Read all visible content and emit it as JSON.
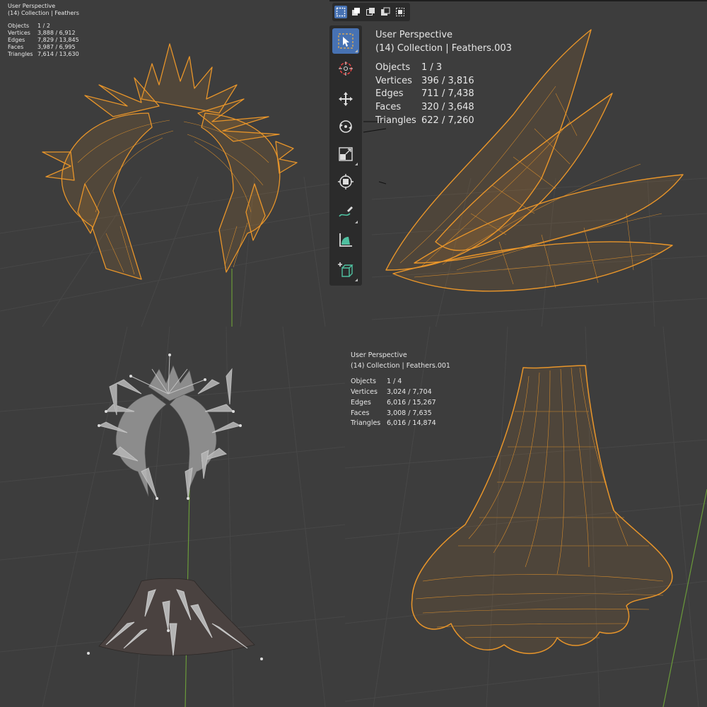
{
  "colors": {
    "wire": "#e8952a",
    "background": "#3d3d3d",
    "grid": "#4a4a4a",
    "axis_y": "#6a9a3a",
    "active_tool": "#4772b3",
    "bone": "#b4b4b4"
  },
  "viewports": {
    "top_left": {
      "title": "User Perspective",
      "subtitle": "(14) Collection | Feathers",
      "stats": [
        {
          "label": "Objects",
          "value": "1 / 2"
        },
        {
          "label": "Vertices",
          "value": "3,888 / 6,912"
        },
        {
          "label": "Edges",
          "value": "7,829 / 13,845"
        },
        {
          "label": "Faces",
          "value": "3,987 / 6,995"
        },
        {
          "label": "Triangles",
          "value": "7,614 / 13,630"
        }
      ]
    },
    "top_right": {
      "title": "User Perspective",
      "subtitle": "(14) Collection | Feathers.003",
      "stats": [
        {
          "label": "Objects",
          "value": "1 / 3"
        },
        {
          "label": "Vertices",
          "value": "396 / 3,816"
        },
        {
          "label": "Edges",
          "value": "711 / 7,438"
        },
        {
          "label": "Faces",
          "value": "320 / 3,648"
        },
        {
          "label": "Triangles",
          "value": "622 / 7,260"
        }
      ]
    },
    "bottom_right": {
      "title": "User Perspective",
      "subtitle": "(14) Collection | Feathers.001",
      "stats": [
        {
          "label": "Objects",
          "value": "1 / 4"
        },
        {
          "label": "Vertices",
          "value": "3,024 / 7,704"
        },
        {
          "label": "Edges",
          "value": "6,016 / 15,267"
        },
        {
          "label": "Faces",
          "value": "3,008 / 7,635"
        },
        {
          "label": "Triangles",
          "value": "6,016 / 14,874"
        }
      ]
    }
  },
  "header_toolbar": {
    "modes": [
      {
        "icon": "select-box-icon",
        "active": true
      },
      {
        "icon": "mode-new-icon",
        "active": false
      },
      {
        "icon": "mode-extend-icon",
        "active": false
      },
      {
        "icon": "mode-subtract-icon",
        "active": false
      },
      {
        "icon": "mode-intersect-icon",
        "active": false
      }
    ]
  },
  "tools": [
    {
      "icon": "select-cursor-icon",
      "active": true
    },
    {
      "icon": "cursor-icon",
      "active": false
    },
    {
      "icon": "move-icon",
      "active": false
    },
    {
      "icon": "rotate-icon",
      "active": false
    },
    {
      "icon": "scale-icon",
      "active": false
    },
    {
      "icon": "transform-icon",
      "active": false
    },
    {
      "icon": "annotate-icon",
      "active": false
    },
    {
      "icon": "measure-icon",
      "active": false
    },
    {
      "icon": "add-cube-icon",
      "active": false
    }
  ]
}
